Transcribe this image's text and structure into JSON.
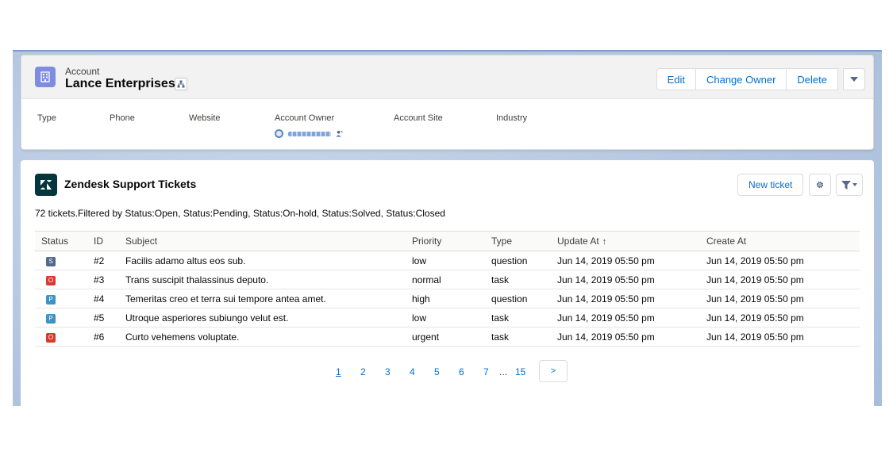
{
  "account": {
    "object_label": "Account",
    "name": "Lance Enterprises",
    "actions": {
      "edit": "Edit",
      "change_owner": "Change Owner",
      "delete": "Delete"
    },
    "fields": {
      "type": "Type",
      "phone": "Phone",
      "website": "Website",
      "account_owner": "Account Owner",
      "account_site": "Account Site",
      "industry": "Industry"
    }
  },
  "zendesk": {
    "title": "Zendesk Support Tickets",
    "new_ticket_label": "New ticket",
    "filter_summary": "72 tickets.Filtered by Status:Open, Status:Pending, Status:On-hold, Status:Solved, Status:Closed",
    "columns": [
      "Status",
      "ID",
      "Subject",
      "Priority",
      "Type",
      "Update At",
      "Create At"
    ],
    "sort_indicator": "↑",
    "rows": [
      {
        "status": "S",
        "status_color": "#54698d",
        "id": "#2",
        "subject": "Facilis adamo altus eos sub.",
        "priority": "low",
        "type": "question",
        "updated": "Jun 14, 2019 05:50 pm",
        "created": "Jun 14, 2019 05:50 pm"
      },
      {
        "status": "O",
        "status_color": "#d73a2f",
        "id": "#3",
        "subject": "Trans suscipit thalassinus deputo.",
        "priority": "normal",
        "type": "task",
        "updated": "Jun 14, 2019 05:50 pm",
        "created": "Jun 14, 2019 05:50 pm"
      },
      {
        "status": "P",
        "status_color": "#3b93c8",
        "id": "#4",
        "subject": "Temeritas creo et terra sui tempore antea amet.",
        "priority": "high",
        "type": "question",
        "updated": "Jun 14, 2019 05:50 pm",
        "created": "Jun 14, 2019 05:50 pm"
      },
      {
        "status": "P",
        "status_color": "#3b93c8",
        "id": "#5",
        "subject": "Utroque asperiores subiungo velut est.",
        "priority": "low",
        "type": "task",
        "updated": "Jun 14, 2019 05:50 pm",
        "created": "Jun 14, 2019 05:50 pm"
      },
      {
        "status": "O",
        "status_color": "#d73a2f",
        "id": "#6",
        "subject": "Curto vehemens voluptate.",
        "priority": "urgent",
        "type": "task",
        "updated": "Jun 14, 2019 05:50 pm",
        "created": "Jun 14, 2019 05:50 pm"
      }
    ],
    "pagination": {
      "pages": [
        "1",
        "2",
        "3",
        "4",
        "5",
        "6",
        "7"
      ],
      "ellipsis": "...",
      "last": "15",
      "next": ">",
      "current": "1"
    }
  },
  "icons": {
    "account": "building-icon",
    "hierarchy": "hierarchy-icon",
    "menu": "chevron-down-icon",
    "zendesk": "zendesk-logo",
    "settings": "gear-icon",
    "filter": "filter-icon"
  },
  "colors": {
    "link": "#0070d2",
    "account_icon": "#7f8de1",
    "zendesk_brand": "#03363d"
  }
}
